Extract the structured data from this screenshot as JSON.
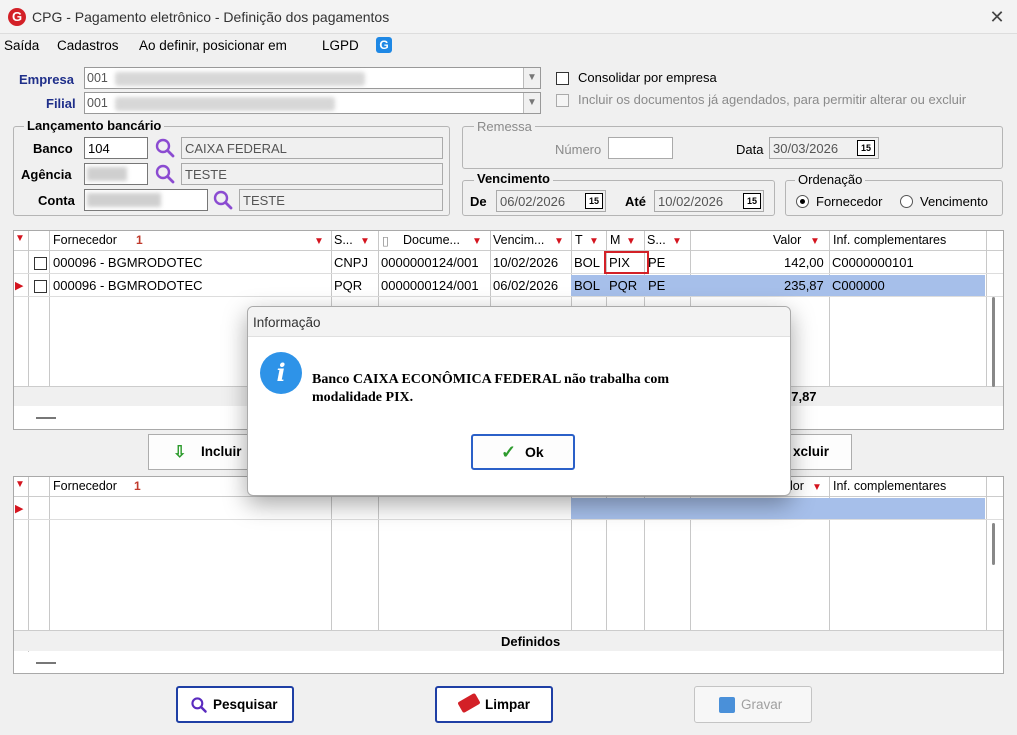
{
  "window": {
    "title": "CPG - Pagamento eletrônico - Definição dos pagamentos",
    "app_logo": "G",
    "close": "✕"
  },
  "menu": {
    "items": [
      "Saída",
      "Cadastros",
      "Ao definir, posicionar em",
      "LGPD"
    ]
  },
  "empresa": {
    "label": "Empresa",
    "value": "001"
  },
  "filial": {
    "label": "Filial",
    "value": "001"
  },
  "options": {
    "consolidar": "Consolidar por empresa",
    "incluir_agendados": "Incluir os documentos já agendados, para permitir alterar ou excluir"
  },
  "lancamento": {
    "title": "Lançamento bancário",
    "banco_label": "Banco",
    "banco_code": "104",
    "banco_name": "CAIXA FEDERAL",
    "agencia_label": "Agência",
    "agencia_name": "TESTE",
    "conta_label": "Conta",
    "conta_name": "TESTE"
  },
  "remessa": {
    "title": "Remessa",
    "numero_label": "Número",
    "numero_value": "",
    "data_label": "Data",
    "data_value": "30/03/2026"
  },
  "vencimento": {
    "title": "Vencimento",
    "de_label": "De",
    "de_value": "06/02/2026",
    "ate_label": "Até",
    "ate_value": "10/02/2026"
  },
  "ordenacao": {
    "title": "Ordenação",
    "opt1": "Fornecedor",
    "opt2": "Vencimento",
    "selected": "Fornecedor"
  },
  "grid_top": {
    "headers": [
      "Fornecedor",
      "S...",
      "Docume...",
      "Vencim...",
      "T",
      "M",
      "S...",
      "Valor",
      "Inf. complementares"
    ],
    "sort_marker": "1",
    "rows": [
      {
        "fornecedor": "000096 - BGMRODOTEC",
        "s": "CNPJ",
        "doc": "0000000124/001",
        "venc": "10/02/2026",
        "t": "BOL",
        "m": "PIX",
        "s2": "PE",
        "valor": "142,00",
        "inf": "C0000000101"
      },
      {
        "fornecedor": "000096 - BGMRODOTEC",
        "s": "PQR",
        "doc": "0000000124/001",
        "venc": "06/02/2026",
        "t": "BOL",
        "m": "PQR",
        "s2": "PE",
        "valor": "235,87",
        "inf": "C000000"
      }
    ],
    "total_partial": "77,87"
  },
  "mid_buttons": {
    "incluir": "Incluir",
    "excluir": "xcluir"
  },
  "grid_bottom": {
    "headers": [
      "Fornecedor",
      "lor",
      "Inf. complementares"
    ],
    "sort_marker": "1",
    "footer_label": "Definidos"
  },
  "buttons": {
    "pesquisar": "Pesquisar",
    "limpar": "Limpar",
    "gravar": "Gravar"
  },
  "dialog": {
    "title": "Informação",
    "icon": "i",
    "message_line1": "Banco CAIXA ECONÔMICA FEDERAL não trabalha com",
    "message_line2": "modalidade PIX.",
    "ok_label": "Ok"
  },
  "colors": {
    "accent": "#1f2f8a",
    "selection": "#a6bfea",
    "filter": "#d4141e",
    "highlight_box": "#d32027",
    "info": "#2e93e8"
  }
}
